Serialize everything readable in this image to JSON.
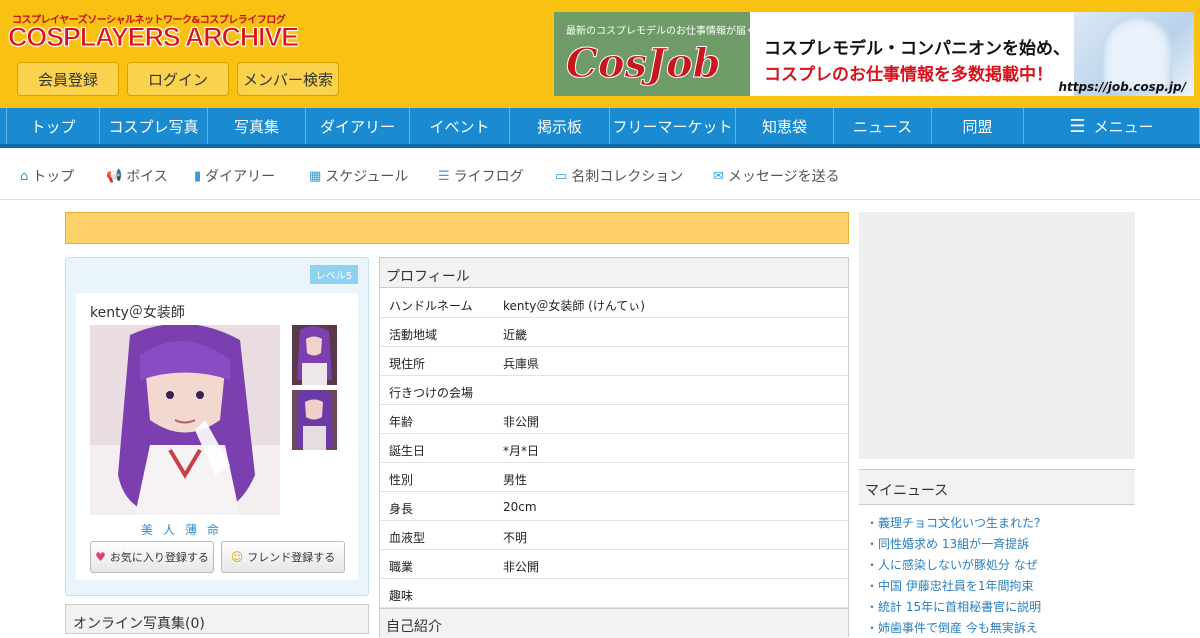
{
  "header": {
    "logo_sub": "コスプレイヤーズソーシャルネットワーク&コスプレライフログ",
    "logo_main": "COSPLAYERS ARCHIVE",
    "buttons": [
      "会員登録",
      "ログイン",
      "メンバー検索"
    ],
    "banner": {
      "small": "最新のコスプレモデルのお仕事情報が届く",
      "logo": "CosJob",
      "line1": "コスプレモデル・コンパニオンを始め、",
      "line2": "コスプレのお仕事情報を多数掲載中！",
      "url": "https://job.cosp.jp/"
    }
  },
  "nav": [
    "トップ",
    "コスプレ写真",
    "写真集",
    "ダイアリー",
    "イベント",
    "掲示板",
    "フリーマーケット",
    "知恵袋",
    "ニュース",
    "同盟",
    "メニュー"
  ],
  "subnav": [
    {
      "icon": "home-icon",
      "label": "トップ"
    },
    {
      "icon": "megaphone-icon",
      "label": "ボイス"
    },
    {
      "icon": "book-icon",
      "label": "ダイアリー"
    },
    {
      "icon": "calendar-icon",
      "label": "スケジュール"
    },
    {
      "icon": "list-icon",
      "label": "ライフログ"
    },
    {
      "icon": "card-icon",
      "label": "名刺コレクション"
    },
    {
      "icon": "envelope-icon",
      "label": "メッセージを送る"
    }
  ],
  "profile_card": {
    "level": "レベル5",
    "name": "kenty＠女装師",
    "tagline": "美人薄命",
    "favorite_button": "お気に入り登録する",
    "friend_button": "フレンド登録する"
  },
  "online_albums": "オンライン写真集(0)",
  "profile": {
    "title": "プロフィール",
    "rows": [
      {
        "key": "ハンドルネーム",
        "value": "kenty＠女装師 (けんてぃ)"
      },
      {
        "key": "活動地域",
        "value": "近畿"
      },
      {
        "key": "現住所",
        "value": "兵庫県"
      },
      {
        "key": "行きつけの会場",
        "value": ""
      },
      {
        "key": "年齢",
        "value": "非公開"
      },
      {
        "key": "誕生日",
        "value": "*月*日"
      },
      {
        "key": "性別",
        "value": "男性"
      },
      {
        "key": "身長",
        "value": "20cm"
      },
      {
        "key": "血液型",
        "value": "不明"
      },
      {
        "key": "職業",
        "value": "非公開"
      },
      {
        "key": "趣味",
        "value": ""
      }
    ],
    "intro_title": "自己紹介"
  },
  "mynews": {
    "title": "マイニュース",
    "items": [
      "・義理チョコ文化いつ生まれた?",
      "・同性婚求め 13組が一斉提訴",
      "・人に感染しないが豚処分 なぜ",
      "・中国 伊藤忠社員を1年間拘束",
      "・統計 15年に首相秘書官に説明",
      "・姉歯事件で倒産 今も無実訴え"
    ]
  },
  "colors": {
    "header_bg": "#f9c112",
    "nav_bg": "#1a8bd0",
    "accent_link": "#2a7fc0",
    "notice_bg": "#fed26a"
  }
}
